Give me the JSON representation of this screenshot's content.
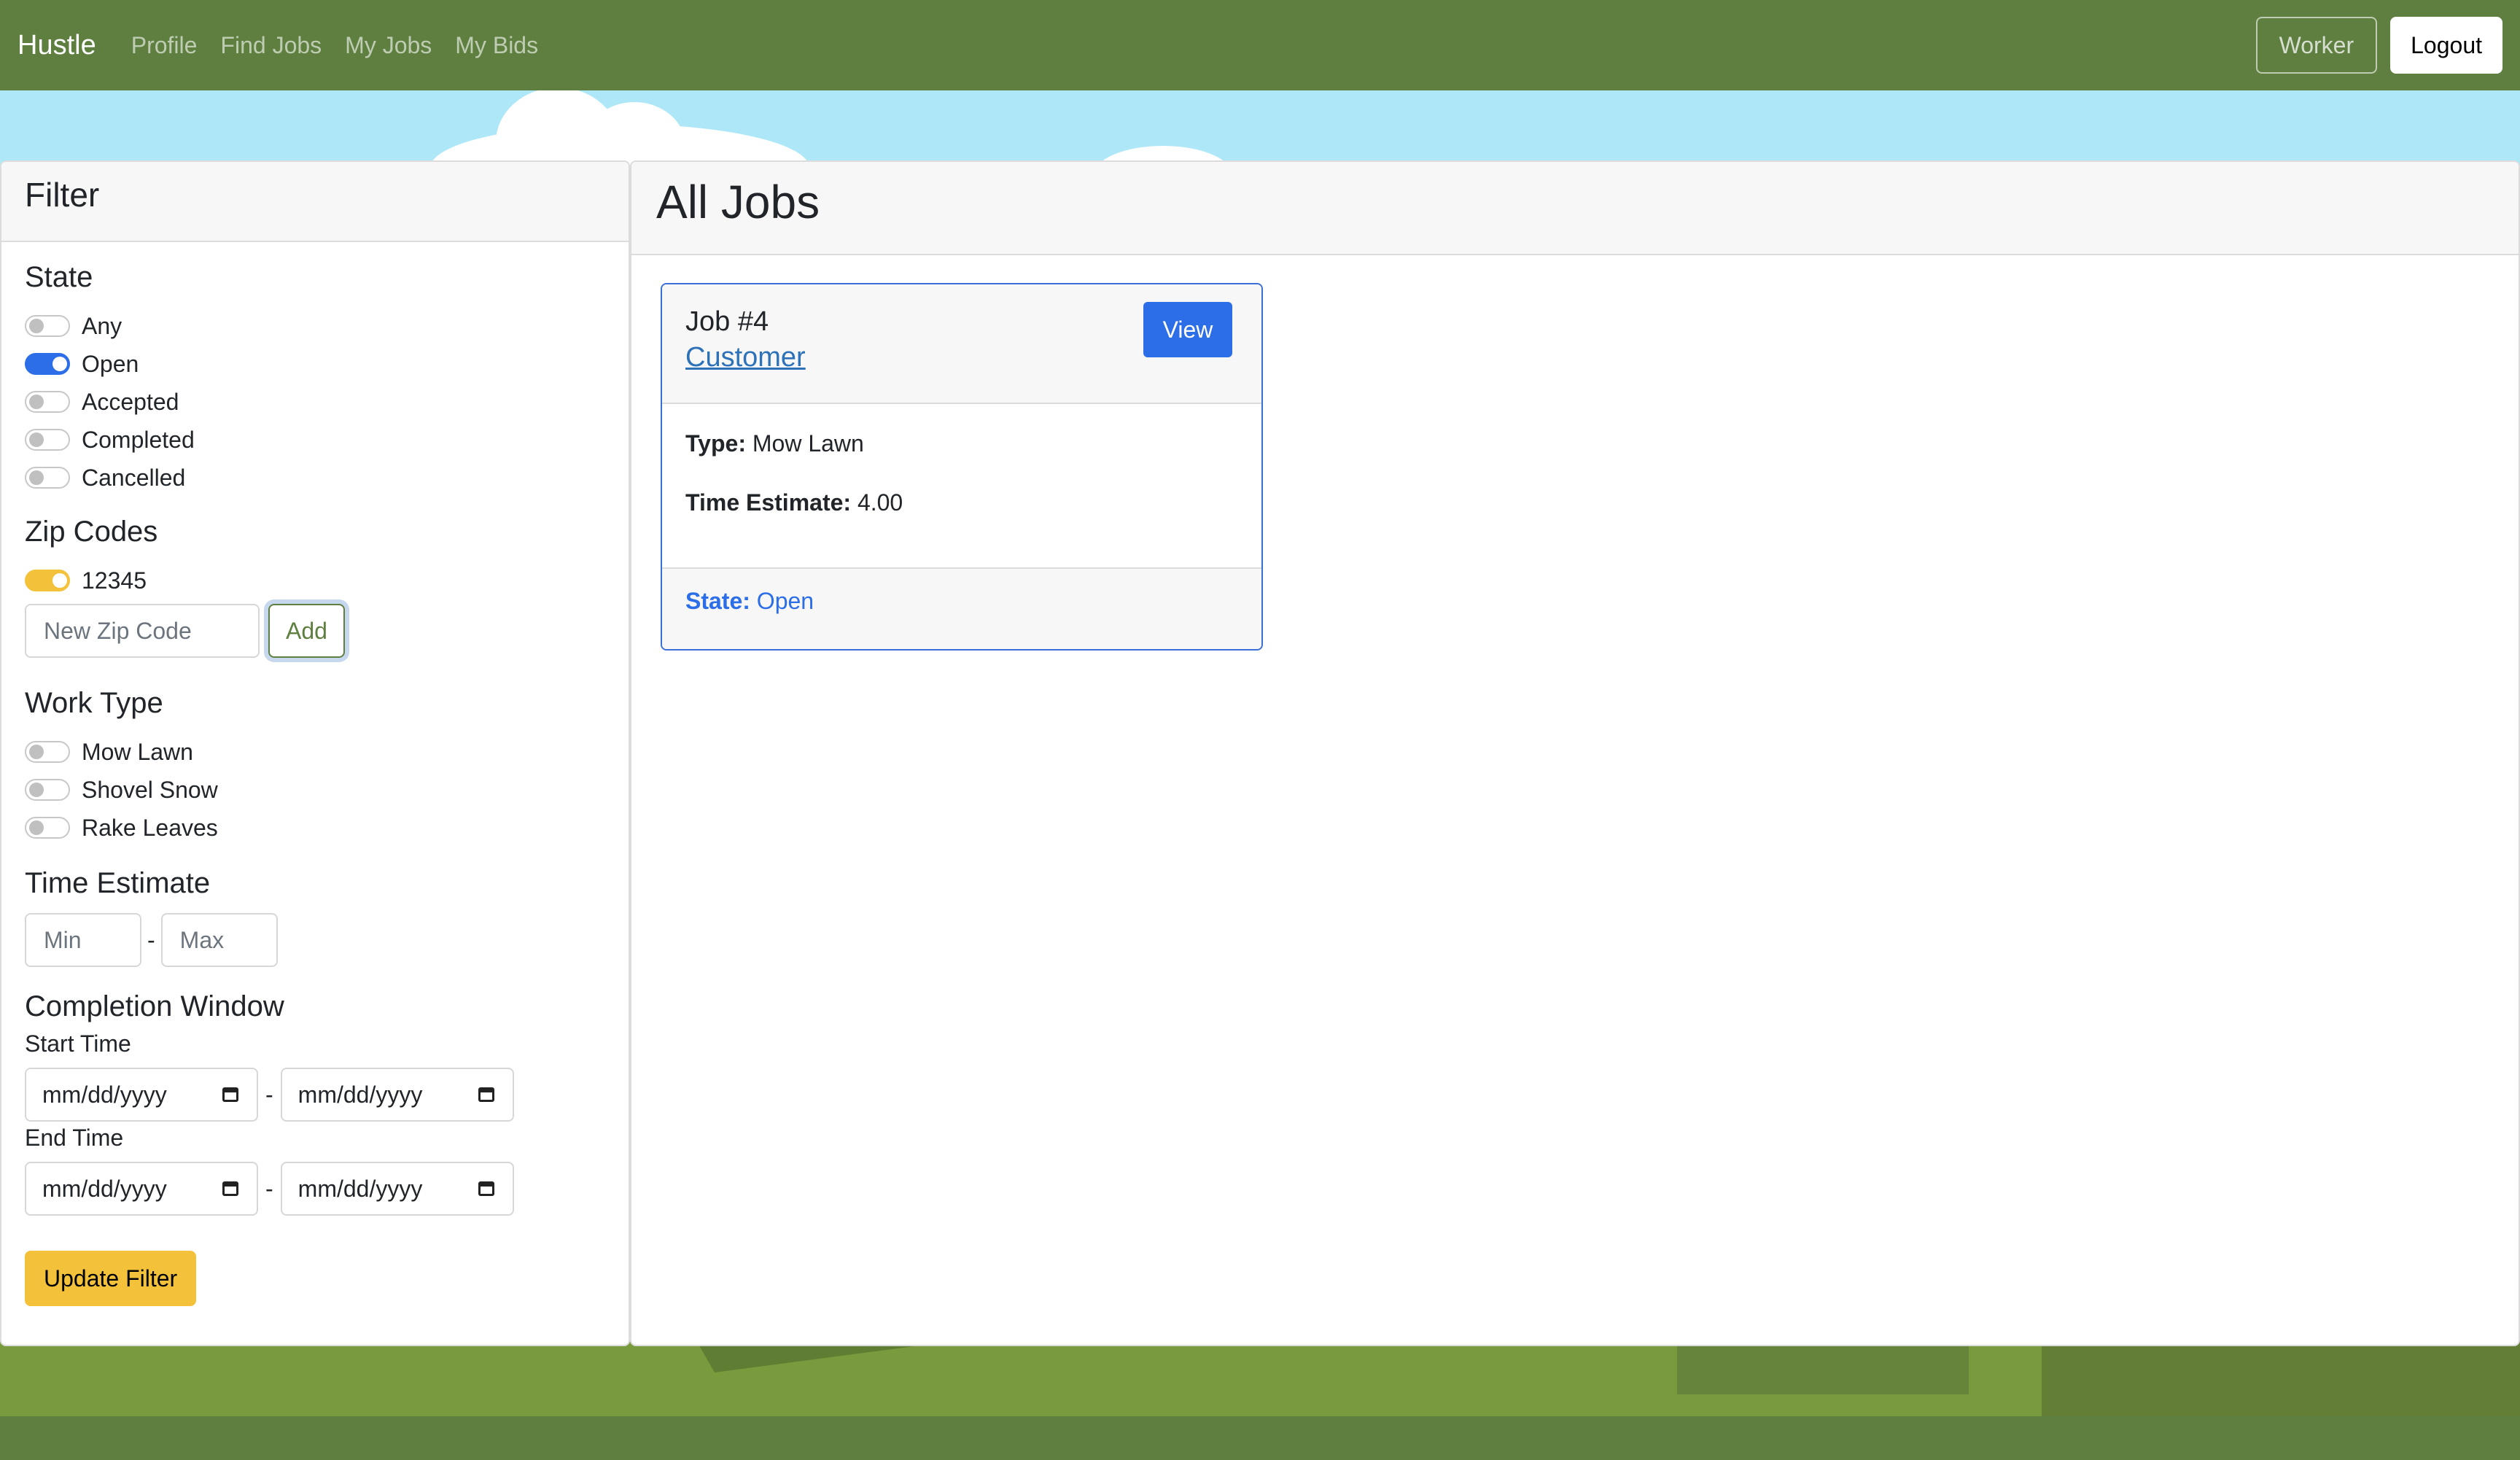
{
  "navbar": {
    "brand": "Hustle",
    "links": [
      "Profile",
      "Find Jobs",
      "My Jobs",
      "My Bids"
    ],
    "role_button": "Worker",
    "logout_button": "Logout"
  },
  "filter": {
    "title": "Filter",
    "state": {
      "title": "State",
      "options": [
        {
          "label": "Any",
          "on": false
        },
        {
          "label": "Open",
          "on": true
        },
        {
          "label": "Accepted",
          "on": false
        },
        {
          "label": "Completed",
          "on": false
        },
        {
          "label": "Cancelled",
          "on": false
        }
      ]
    },
    "zip_codes": {
      "title": "Zip Codes",
      "items": [
        {
          "label": "12345",
          "on": true
        }
      ],
      "new_placeholder": "New Zip Code",
      "add_button": "Add"
    },
    "work_type": {
      "title": "Work Type",
      "options": [
        {
          "label": "Mow Lawn",
          "on": false
        },
        {
          "label": "Shovel Snow",
          "on": false
        },
        {
          "label": "Rake Leaves",
          "on": false
        }
      ]
    },
    "time_estimate": {
      "title": "Time Estimate",
      "min_placeholder": "Min",
      "max_placeholder": "Max",
      "separator": "-"
    },
    "completion_window": {
      "title": "Completion Window",
      "start_label": "Start Time",
      "end_label": "End Time",
      "date_placeholder": "mm/dd/yyyy",
      "separator": "-"
    },
    "update_button": "Update Filter"
  },
  "jobs": {
    "title": "All Jobs",
    "cards": [
      {
        "title": "Job #4",
        "customer": "Customer",
        "view_button": "View",
        "type_label": "Type:",
        "type_value": "Mow Lawn",
        "time_label": "Time Estimate:",
        "time_value": "4.00",
        "state_label": "State:",
        "state_value": "Open"
      }
    ]
  },
  "colors": {
    "navbar": "#5e7f40",
    "primary": "#2c6de8",
    "warning": "#f4c23a",
    "sky": "#aee8f8"
  }
}
